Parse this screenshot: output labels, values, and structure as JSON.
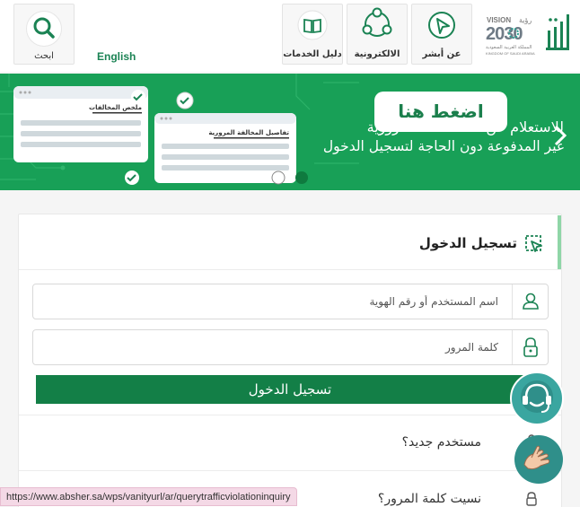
{
  "header": {
    "search_label": "ابحث",
    "language_link": "English",
    "tiles": [
      {
        "label": "دليل الخدمات",
        "icon": "book-icon"
      },
      {
        "label": "الالكترونية",
        "icon": "network-icon"
      },
      {
        "label": "عن أبشر",
        "icon": "cursor-icon"
      }
    ],
    "vision_logo": {
      "word": "VISION",
      "arabic": "رؤية",
      "year": "2030",
      "caption": "المملكة العربية السعودية",
      "caption_en": "KINGDOM OF SAUDI ARABIA"
    },
    "absher_logo": "أبشر"
  },
  "banner": {
    "button_label": "اضغط هنا",
    "line1": "للاستعلام عن المخالفات المرورية",
    "line2": "غير المدفوعة دون الحاجة لتسجيل الدخول",
    "card_front_title": "تفاصيل المخالفة المرورية",
    "card_back_title": "ملخص المخالفات",
    "background_color": "#18a057"
  },
  "login": {
    "title": "تسجيل الدخول",
    "username_placeholder": "اسم المستخدم أو رقم الهوية",
    "password_placeholder": "كلمة المرور",
    "submit_label": "تسجيل الدخول",
    "new_user": "مستخدم جديد؟",
    "forgot_password": "نسيت كلمة المرور؟",
    "accent_color": "#137f47"
  },
  "status_url": "https://www.absher.sa/wps/vanityurl/ar/querytrafficviolationinquiry"
}
